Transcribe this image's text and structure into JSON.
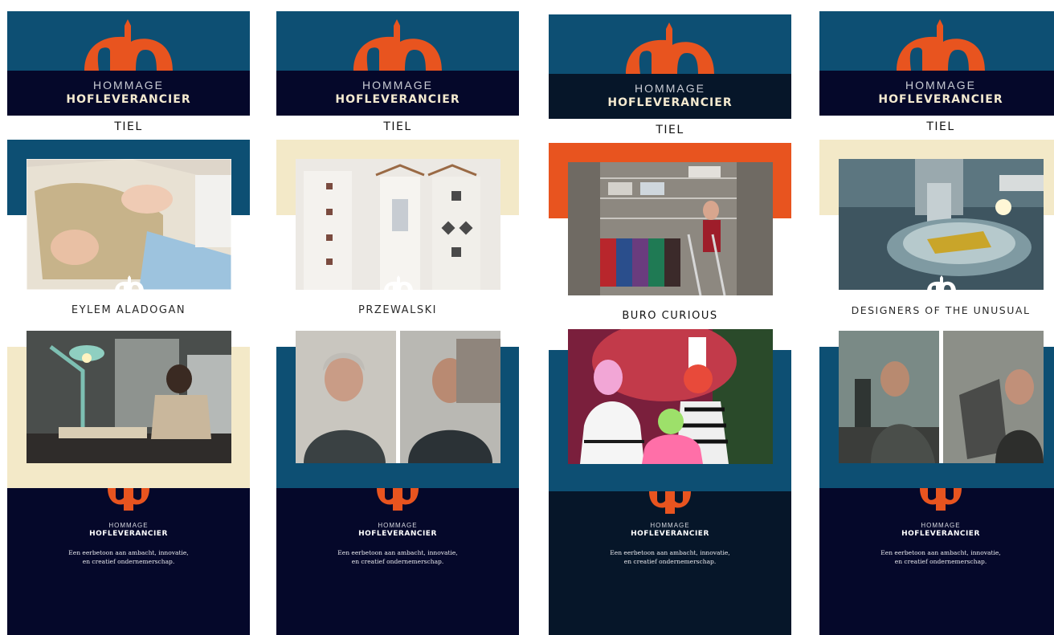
{
  "brand": {
    "line1": "HOMMAGE",
    "line2": "HOFLEVERANCIER",
    "city": "TIEL",
    "tagline_l1": "Een eerbetoon aan ambacht, innovatie,",
    "tagline_l2": "en creatief ondernemerschap.",
    "colors": {
      "orange": "#e8541f",
      "teal": "#0d4f73",
      "navy": "#05082a",
      "cream": "#f3e9c8",
      "black": "#061629"
    },
    "logo_icon": "ch-monogram-icon"
  },
  "posters": [
    {
      "name": "EYLEM ALADOGAN",
      "photo1": "embroidery-hands-photo",
      "photo2": "woman-sewing-at-desk-photo"
    },
    {
      "name": "PRZEWALSKI",
      "photo1": "hanging-textile-garments-photo",
      "photo2": "two-portraits-photo"
    },
    {
      "name": "BURO CURIOUS",
      "photo1": "costume-storage-rack-photo",
      "photo2": "clown-performers-photo"
    },
    {
      "name": "DESIGNERS OF THE UNUSUAL",
      "photo1": "microscope-sample-photo",
      "photo2": "two-designers-lab-photo"
    }
  ]
}
